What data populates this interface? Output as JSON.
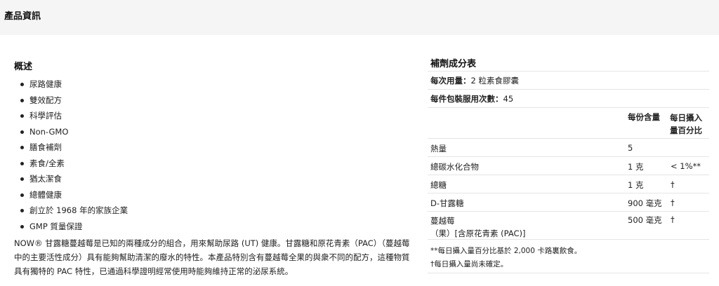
{
  "header": {
    "title": "產品資訊"
  },
  "overview": {
    "title": "概述",
    "features": [
      "尿路健康",
      "雙效配方",
      "科學評估",
      "Non-GMO",
      "膳食補劑",
      "素食/全素",
      "猶太潔食",
      "總體健康",
      "創立於 1968 年的家族企業",
      "GMP 質量保證"
    ],
    "description": "NOW® 甘露糖蔓越莓是已知的兩種成分的組合，用來幫助尿路 (UT) 健康。甘露糖和原花青素（PAC）（蔓越莓中的主要活性成分）具有能夠幫助清潔的廢水的特性。本產品特別含有蔓越莓全果的與衆不同的配方，這種物質具有獨特的 PAC 特性，已通過科學證明經常使用時能夠維持正常的泌尿系統。"
  },
  "supplement_facts": {
    "title": "補劑成分表",
    "serving_size_label": "每次用量：",
    "serving_size_value": "2 粒素食膠囊",
    "servings_label": "每件包裝服用次數：",
    "servings_value": "45",
    "col_amount": "每份含量",
    "col_daily_value": "每日攝入量百分比",
    "rows": [
      {
        "name": "熱量",
        "amount": "5",
        "dv": ""
      },
      {
        "name": "總碳水化合物",
        "amount": "1 克",
        "dv": "< 1%**"
      },
      {
        "name": "總糖",
        "amount": "1 克",
        "dv": "†"
      },
      {
        "name": "D-甘露糖",
        "amount": "900 毫克",
        "dv": "†"
      },
      {
        "name": "蔓越莓\n（果）[含原花青素 (PAC)]",
        "amount": "500 毫克",
        "dv": "†"
      }
    ],
    "footnote_1": "**每日攝入量百分比基於 2,000 卡路裏飲食。",
    "footnote_2": "†每日攝入量尚未確定。"
  }
}
